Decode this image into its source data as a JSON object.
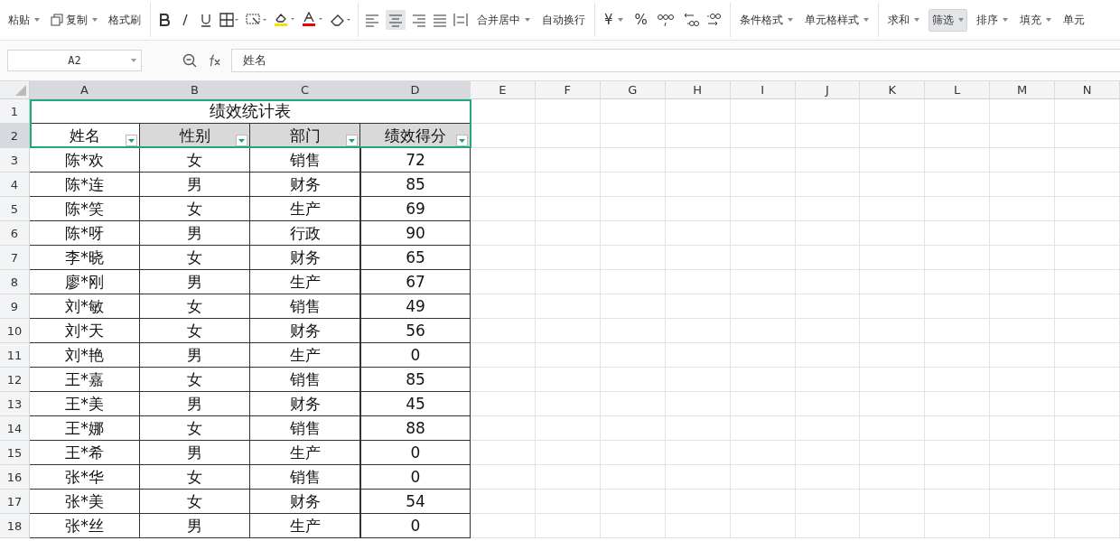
{
  "ribbon": {
    "paste": {
      "label": "粘贴",
      "caret": true
    },
    "copy": {
      "label": "复制",
      "caret": true
    },
    "format_painter": {
      "label": "格式刷"
    },
    "merge": {
      "label": "合并居中",
      "caret": true
    },
    "wrap": {
      "label": "自动换行"
    },
    "currency": {
      "symbol": "¥",
      "caret": true
    },
    "percent": {
      "symbol": "%"
    },
    "styles": [
      {
        "label": "条件格式",
        "caret": true
      },
      {
        "label": "单元格样式",
        "caret": true
      }
    ],
    "tools": [
      {
        "label": "求和",
        "caret": true,
        "selected": false
      },
      {
        "label": "筛选",
        "caret": true,
        "selected": true
      },
      {
        "label": "排序",
        "caret": true,
        "selected": false
      },
      {
        "label": "填充",
        "caret": true,
        "selected": false
      },
      {
        "label": "单元",
        "caret": false,
        "selected": false
      }
    ]
  },
  "formula_bar": {
    "name_box": "A2",
    "value": "姓名"
  },
  "columns": [
    {
      "label": "A",
      "highlighted": true
    },
    {
      "label": "B",
      "highlighted": true
    },
    {
      "label": "C",
      "highlighted": true
    },
    {
      "label": "D",
      "highlighted": true
    },
    {
      "label": "E",
      "highlighted": false
    },
    {
      "label": "F",
      "highlighted": false
    },
    {
      "label": "G",
      "highlighted": false
    },
    {
      "label": "H",
      "highlighted": false
    },
    {
      "label": "I",
      "highlighted": false
    },
    {
      "label": "J",
      "highlighted": false
    },
    {
      "label": "K",
      "highlighted": false
    },
    {
      "label": "L",
      "highlighted": false
    },
    {
      "label": "M",
      "highlighted": false
    },
    {
      "label": "N",
      "highlighted": false
    }
  ],
  "title_row": {
    "number": "1",
    "title": "绩效统计表"
  },
  "header_row": {
    "number": "2",
    "selected": true,
    "cells": [
      {
        "text": "姓名",
        "active": true
      },
      {
        "text": "性别",
        "active": false
      },
      {
        "text": "部门",
        "active": false
      },
      {
        "text": "绩效得分",
        "active": false
      }
    ]
  },
  "rows": [
    {
      "number": "3",
      "cells": [
        "陈*欢",
        "女",
        "销售",
        "72"
      ]
    },
    {
      "number": "4",
      "cells": [
        "陈*连",
        "男",
        "财务",
        "85"
      ]
    },
    {
      "number": "5",
      "cells": [
        "陈*笑",
        "女",
        "生产",
        "69"
      ]
    },
    {
      "number": "6",
      "cells": [
        "陈*呀",
        "男",
        "行政",
        "90"
      ]
    },
    {
      "number": "7",
      "cells": [
        "李*晓",
        "女",
        "财务",
        "65"
      ]
    },
    {
      "number": "8",
      "cells": [
        "廖*刚",
        "男",
        "生产",
        "67"
      ]
    },
    {
      "number": "9",
      "cells": [
        "刘*敏",
        "女",
        "销售",
        "49"
      ]
    },
    {
      "number": "10",
      "cells": [
        "刘*天",
        "女",
        "财务",
        "56"
      ]
    },
    {
      "number": "11",
      "cells": [
        "刘*艳",
        "男",
        "生产",
        "0"
      ]
    },
    {
      "number": "12",
      "cells": [
        "王*嘉",
        "女",
        "销售",
        "85"
      ]
    },
    {
      "number": "13",
      "cells": [
        "王*美",
        "男",
        "财务",
        "45"
      ]
    },
    {
      "number": "14",
      "cells": [
        "王*娜",
        "女",
        "销售",
        "88"
      ]
    },
    {
      "number": "15",
      "cells": [
        "王*希",
        "男",
        "生产",
        "0"
      ]
    },
    {
      "number": "16",
      "cells": [
        "张*华",
        "女",
        "销售",
        "0"
      ]
    },
    {
      "number": "17",
      "cells": [
        "张*美",
        "女",
        "财务",
        "54"
      ]
    },
    {
      "number": "18",
      "cells": [
        "张*丝",
        "男",
        "生产",
        "0"
      ]
    }
  ]
}
